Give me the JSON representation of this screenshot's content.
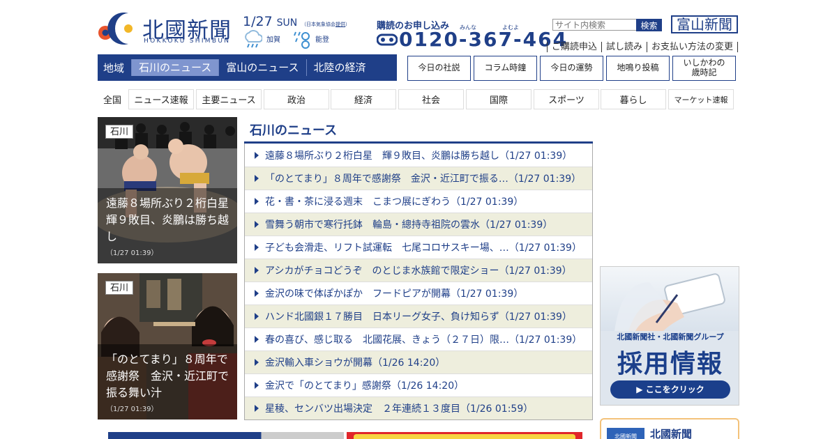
{
  "header": {
    "logo_jp": "北國新聞",
    "logo_en": "HOKKOKU SHIMBUN",
    "date": "1/27",
    "dow": "SUN",
    "weather_note_prefix": "（日本気象協会",
    "weather_note_link": "提供",
    "weather_note_suffix": "）",
    "weather": [
      {
        "area": "加賀",
        "icon": "cloud-rain-icon"
      },
      {
        "area": "能登",
        "icon": "snow-rain-icon"
      }
    ],
    "subscribe_label": "購読のお申し込み",
    "ruby_1": "みんな",
    "ruby_2": "よむよ",
    "phone_number": "0120-367-464",
    "search_placeholder": "サイト内検索",
    "search_button": "検索",
    "toyama_logo": "富山新聞",
    "sub_links": [
      "ご購読申込",
      "試し読み",
      "お支払い方法の変更"
    ]
  },
  "region_nav": {
    "label": "地域",
    "tabs": [
      "石川のニュース",
      "富山のニュース",
      "北陸の経済"
    ],
    "active_index": 0
  },
  "top_buttons": [
    "今日の社説",
    "コラム時鐘",
    "今日の運勢",
    "地鳴り投稿",
    "いしかわの\n歳時記"
  ],
  "categories": [
    "全国",
    "ニュース速報",
    "主要ニュース",
    "政治",
    "経済",
    "社会",
    "国際",
    "スポーツ",
    "暮らし",
    "マーケット速報"
  ],
  "cards": [
    {
      "tag": "石川",
      "caption": "遠藤８場所ぶり２桁白星　輝９敗目、炎鵬は勝ち越し",
      "time": "（1/27 01:39）"
    },
    {
      "tag": "石川",
      "caption": "「のとてまり」８周年で感謝祭　金沢・近江町で振る舞い汁",
      "time": "（1/27 01:39）"
    }
  ],
  "news": {
    "title": "石川のニュース",
    "items": [
      "遠藤８場所ぶり２桁白星　輝９敗目、炎鵬は勝ち越し（1/27 01:39）",
      "「のとてまり」８周年で感謝祭　金沢・近江町で振る…（1/27 01:39）",
      "花・書・茶に浸る週末　こまつ展にぎわう（1/27 01:39）",
      "雪舞う朝市で寒行托鉢　輪島・總持寺祖院の雲水（1/27 01:39）",
      "子ども会滑走、リフト試運転　七尾コロサスキー場、…（1/27 01:39）",
      "アシカがチョコどうぞ　のとじま水族館で限定ショー（1/27 01:39）",
      "金沢の味で体ぽかぽか　フードピアが開幕（1/27 01:39）",
      "ハンド北國銀１７勝目　日本リーグ女子、負け知らず（1/27 01:39）",
      "春の喜び、感じ取る　北國花展、きょう（２７日）限…（1/27 01:39）",
      "金沢輸入車ショウが開幕（1/26 14:20）",
      "金沢で「のとてまり」感謝祭（1/26 14:20）",
      "星稜、センバツ出場決定　２年連続１３度目（1/26 01:59）"
    ]
  },
  "recruit_banner": {
    "group": "北國新聞社・北國新聞グループ",
    "title": "採用情報",
    "cta": "▶ ここをクリック"
  },
  "paper_box": {
    "mini": "北國新聞",
    "name": "北國新聞"
  },
  "colors": {
    "brand": "#1f3f88",
    "row_alt": "#eeeedd",
    "active_tab": "#7f95cf"
  }
}
